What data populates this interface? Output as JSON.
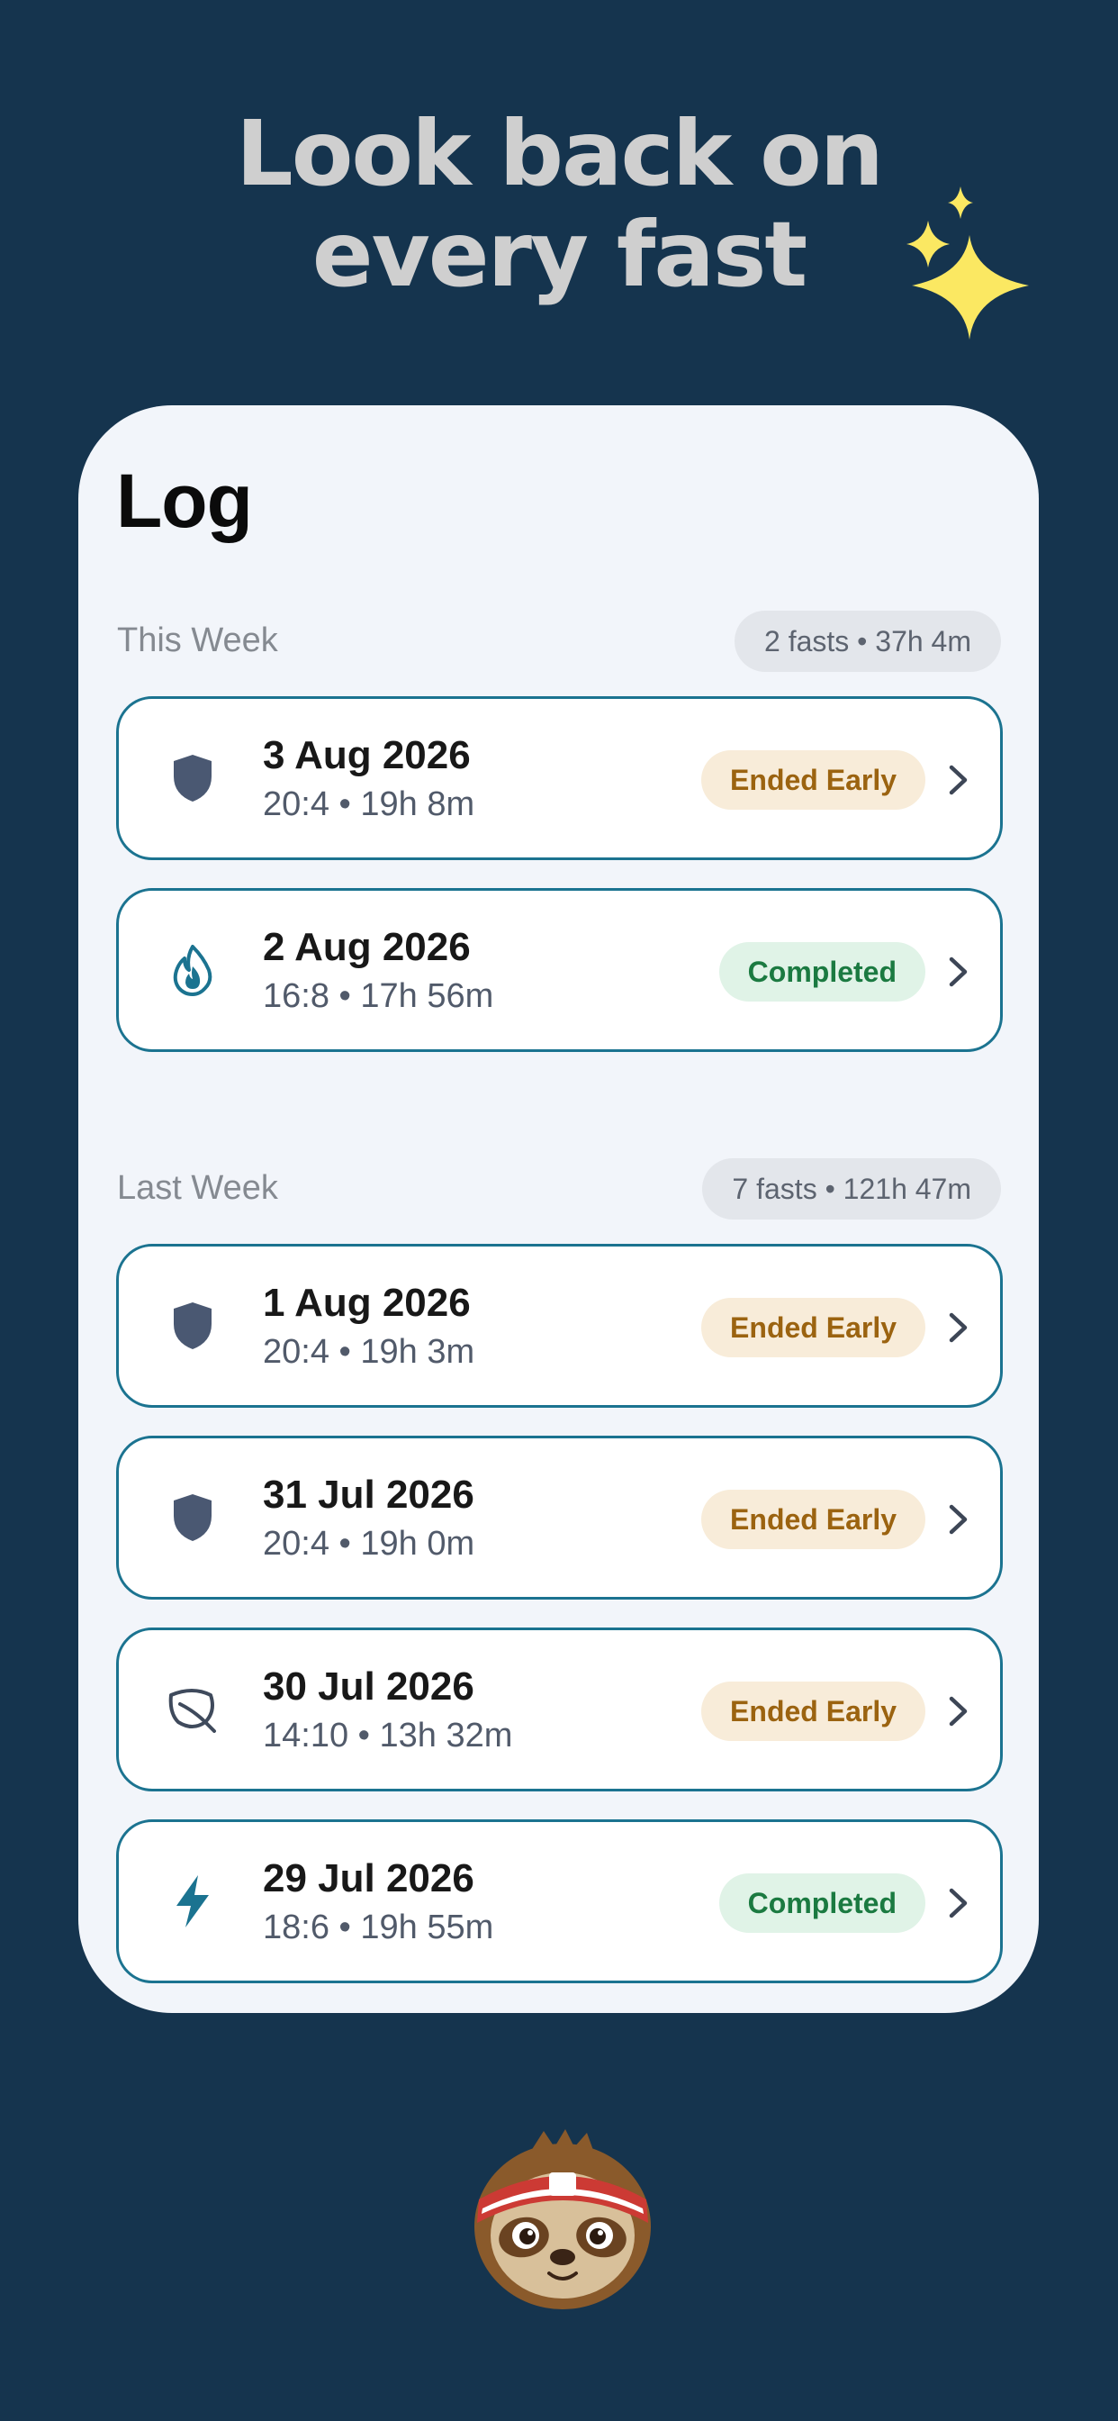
{
  "promo": {
    "headline_line1": "Look back on",
    "headline_line2": "every fast"
  },
  "log": {
    "title": "Log",
    "sections": [
      {
        "label": "This Week",
        "summary": "2 fasts • 37h 4m",
        "entries": [
          {
            "date": "3 Aug 2026",
            "detail": "20:4 • 19h 8m",
            "status": "Ended Early",
            "icon": "shield-icon"
          },
          {
            "date": "2 Aug 2026",
            "detail": "16:8 • 17h 56m",
            "status": "Completed",
            "icon": "flame-icon"
          }
        ]
      },
      {
        "label": "Last Week",
        "summary": "7 fasts • 121h 47m",
        "entries": [
          {
            "date": "1 Aug 2026",
            "detail": "20:4 • 19h 3m",
            "status": "Ended Early",
            "icon": "shield-icon"
          },
          {
            "date": "31 Jul 2026",
            "detail": "20:4 • 19h 0m",
            "status": "Ended Early",
            "icon": "shield-icon"
          },
          {
            "date": "30 Jul 2026",
            "detail": "14:10 • 13h 32m",
            "status": "Ended Early",
            "icon": "leaf-icon"
          },
          {
            "date": "29 Jul 2026",
            "detail": "18:6 • 19h 55m",
            "status": "Completed",
            "icon": "lightning-icon"
          }
        ]
      }
    ]
  },
  "colors": {
    "background": "#15344e",
    "card": "#f2f5fa",
    "row_border": "#1b7390",
    "ended_early_bg": "#f8ecd9",
    "ended_early_text": "#9b6310",
    "completed_bg": "#e0f3e7",
    "completed_text": "#1b7a41",
    "sparkle": "#fbe862"
  }
}
